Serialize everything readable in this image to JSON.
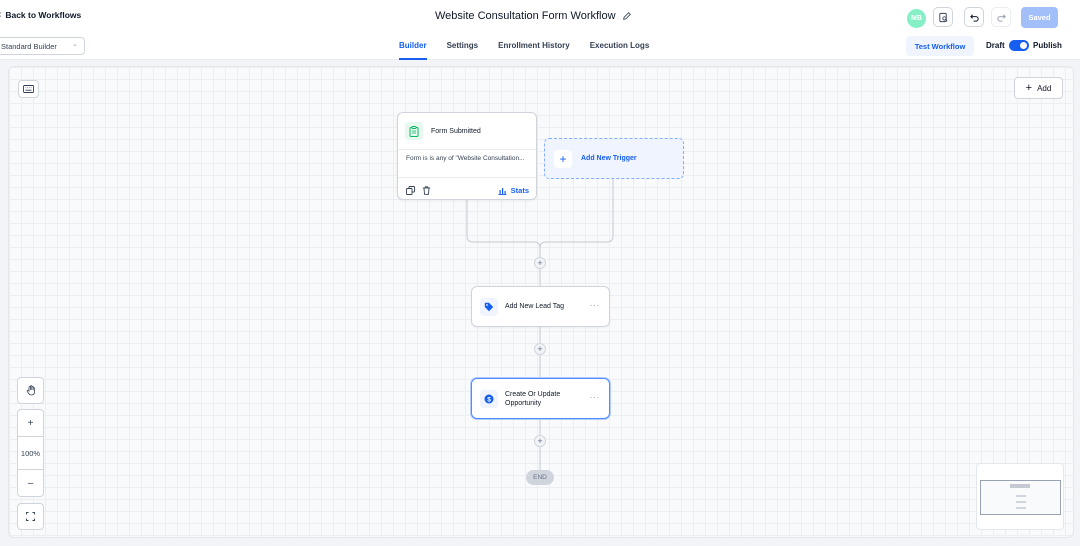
{
  "header": {
    "back_label": "Back to Workflows",
    "workflow_title": "Website Consultation Form Workflow",
    "avatar_initials": "MB",
    "saved_label": "Saved"
  },
  "subbar": {
    "builder_mode": "Standard Builder",
    "tabs": [
      {
        "label": "Builder",
        "active": true
      },
      {
        "label": "Settings",
        "active": false
      },
      {
        "label": "Enrollment History",
        "active": false
      },
      {
        "label": "Execution Logs",
        "active": false
      }
    ],
    "test_label": "Test Workflow",
    "draft_label": "Draft",
    "publish_label": "Publish",
    "published": true
  },
  "canvas": {
    "add_label": "Add",
    "trigger": {
      "title": "Form Submitted",
      "description": "Form is is any of \"Website Consultation...",
      "stats_label": "Stats"
    },
    "new_trigger_label": "Add New Trigger",
    "actions": [
      {
        "label": "Add New Lead Tag",
        "icon": "tag-icon"
      },
      {
        "label_line1": "Create Or Update",
        "label_line2": "Opportunity",
        "icon": "dollar-icon"
      }
    ],
    "end_label": "END",
    "zoom_level": "100%"
  },
  "colors": {
    "accent": "#155eef",
    "trigger_icon": "#12b76a",
    "avatar": "#86efc6"
  }
}
